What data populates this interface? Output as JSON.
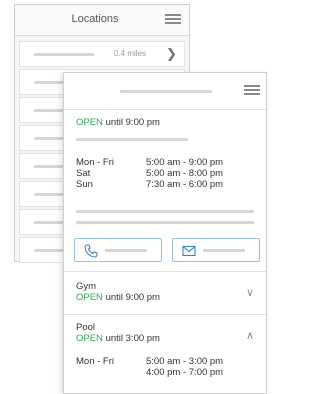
{
  "locations_panel": {
    "title": "Locations",
    "rows": [
      {
        "distance": "0.4 miles"
      },
      {
        "distance": ""
      },
      {
        "distance": ""
      },
      {
        "distance": ""
      },
      {
        "distance": ""
      },
      {
        "distance": ""
      },
      {
        "distance": ""
      },
      {
        "distance": ""
      }
    ]
  },
  "detail_panel": {
    "open_label": "OPEN",
    "status_suffix": " until 9:00 pm",
    "hours": [
      {
        "day": "Mon - Fri",
        "time": "5:00 am - 9:00 pm"
      },
      {
        "day": "Sat",
        "time": "5:00 am - 8:00 pm"
      },
      {
        "day": "Sun",
        "time": "7:30 am - 6:00 pm"
      }
    ],
    "sections": [
      {
        "name": "Gym",
        "open_label": "OPEN",
        "status_suffix": " until 9:00 pm",
        "expanded": false
      },
      {
        "name": "Pool",
        "open_label": "OPEN",
        "status_suffix": " until 3:00 pm",
        "expanded": true,
        "hours": [
          {
            "day": "Mon - Fri",
            "time": "5:00 am - 3:00 pm"
          },
          {
            "day": "",
            "time": "4:00 pm - 7:00 pm"
          }
        ]
      }
    ]
  },
  "colors": {
    "open_green": "#2fa84f",
    "action_blue": "#3b7fc4",
    "placeholder_gray": "#d6d6d6"
  },
  "icons": {
    "phone": "phone-icon",
    "mail": "mail-icon",
    "menu": "hamburger-menu-icon"
  }
}
